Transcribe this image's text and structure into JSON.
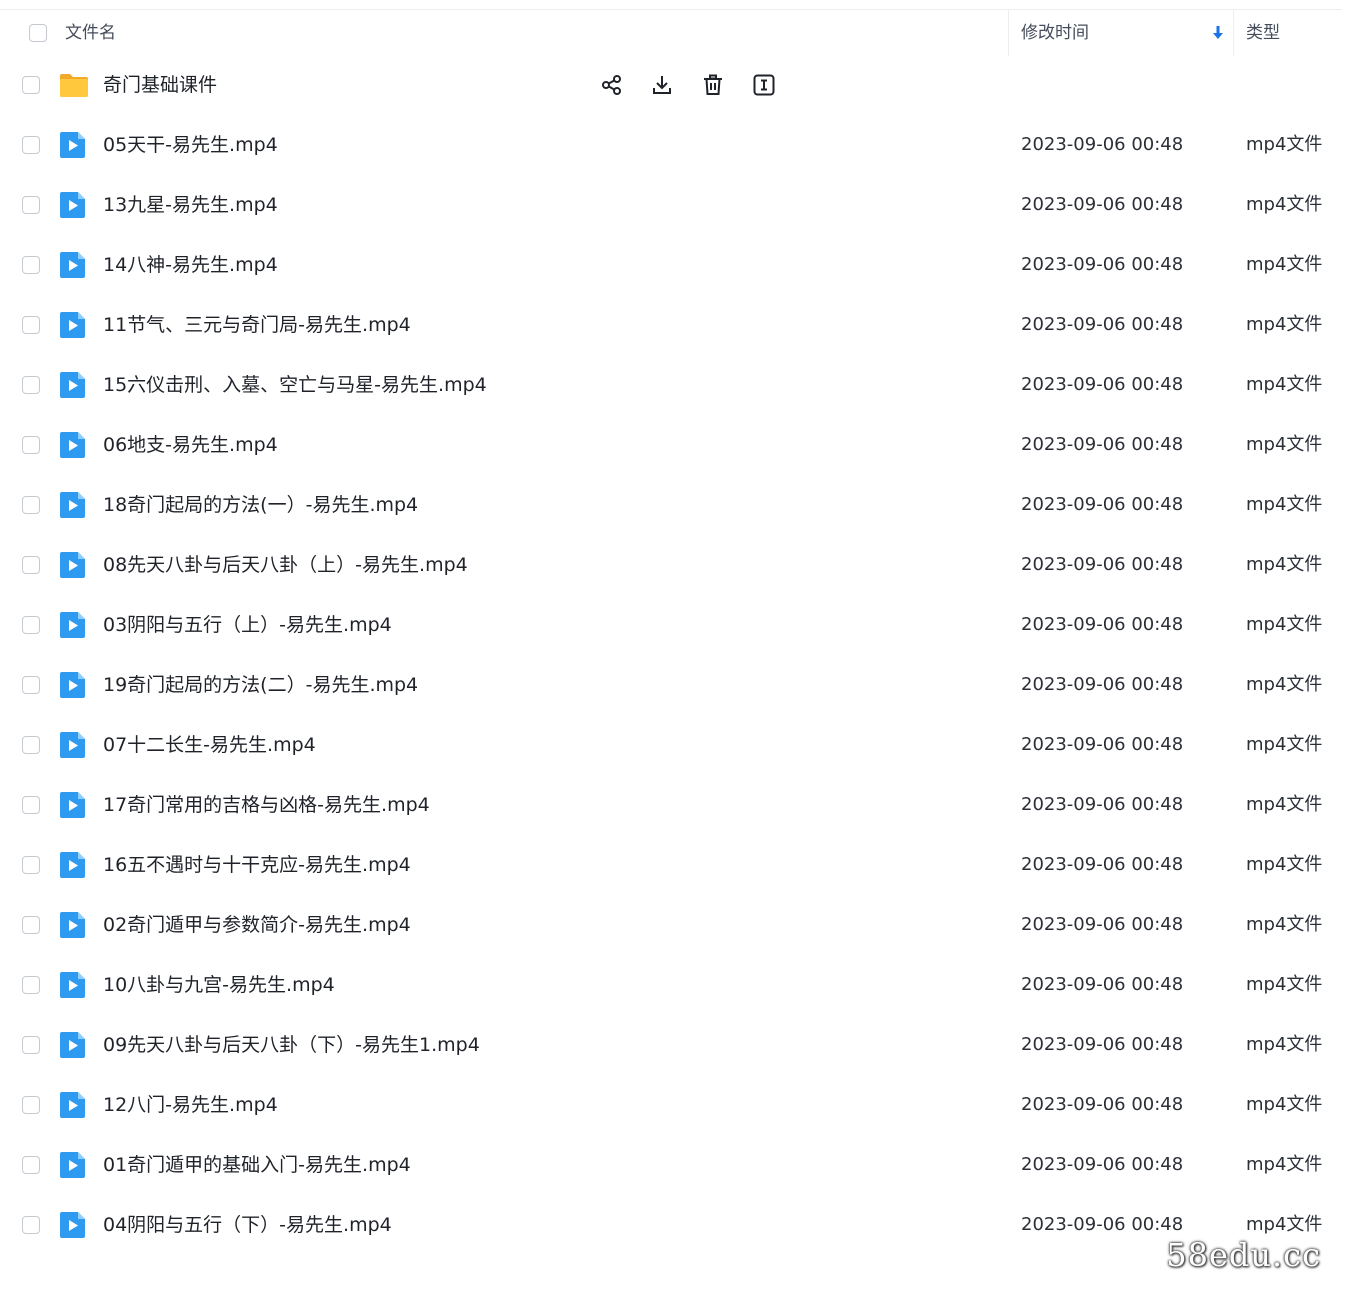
{
  "header": {
    "name_label": "文件名",
    "mtime_label": "修改时间",
    "type_label": "类型"
  },
  "folder": {
    "name": "奇门基础课件",
    "actions": [
      "share-icon",
      "download-icon",
      "delete-icon",
      "rename-icon"
    ]
  },
  "files": [
    {
      "name": "05天干-易先生.mp4",
      "mtime": "2023-09-06 00:48",
      "type": "mp4文件"
    },
    {
      "name": "13九星-易先生.mp4",
      "mtime": "2023-09-06 00:48",
      "type": "mp4文件"
    },
    {
      "name": "14八神-易先生.mp4",
      "mtime": "2023-09-06 00:48",
      "type": "mp4文件"
    },
    {
      "name": "11节气、三元与奇门局-易先生.mp4",
      "mtime": "2023-09-06 00:48",
      "type": "mp4文件"
    },
    {
      "name": "15六仪击刑、入墓、空亡与马星-易先生.mp4",
      "mtime": "2023-09-06 00:48",
      "type": "mp4文件"
    },
    {
      "name": "06地支-易先生.mp4",
      "mtime": "2023-09-06 00:48",
      "type": "mp4文件"
    },
    {
      "name": "18奇门起局的方法(一）-易先生.mp4",
      "mtime": "2023-09-06 00:48",
      "type": "mp4文件"
    },
    {
      "name": "08先天八卦与后天八卦（上）-易先生.mp4",
      "mtime": "2023-09-06 00:48",
      "type": "mp4文件"
    },
    {
      "name": "03阴阳与五行（上）-易先生.mp4",
      "mtime": "2023-09-06 00:48",
      "type": "mp4文件"
    },
    {
      "name": "19奇门起局的方法(二）-易先生.mp4",
      "mtime": "2023-09-06 00:48",
      "type": "mp4文件"
    },
    {
      "name": "07十二长生-易先生.mp4",
      "mtime": "2023-09-06 00:48",
      "type": "mp4文件"
    },
    {
      "name": "17奇门常用的吉格与凶格-易先生.mp4",
      "mtime": "2023-09-06 00:48",
      "type": "mp4文件"
    },
    {
      "name": "16五不遇时与十干克应-易先生.mp4",
      "mtime": "2023-09-06 00:48",
      "type": "mp4文件"
    },
    {
      "name": "02奇门遁甲与参数简介-易先生.mp4",
      "mtime": "2023-09-06 00:48",
      "type": "mp4文件"
    },
    {
      "name": "10八卦与九宫-易先生.mp4",
      "mtime": "2023-09-06 00:48",
      "type": "mp4文件"
    },
    {
      "name": "09先天八卦与后天八卦（下）-易先生1.mp4",
      "mtime": "2023-09-06 00:48",
      "type": "mp4文件"
    },
    {
      "name": "12八门-易先生.mp4",
      "mtime": "2023-09-06 00:48",
      "type": "mp4文件"
    },
    {
      "name": "01奇门遁甲的基础入门-易先生.mp4",
      "mtime": "2023-09-06 00:48",
      "type": "mp4文件"
    },
    {
      "name": "04阴阳与五行（下）-易先生.mp4",
      "mtime": "2023-09-06 00:48",
      "type": "mp4文件"
    }
  ],
  "watermark": "58edu.cc",
  "colors": {
    "accent": "#1a73e8",
    "folder": "#f7c33f",
    "video_icon": "#2e9bf0"
  }
}
